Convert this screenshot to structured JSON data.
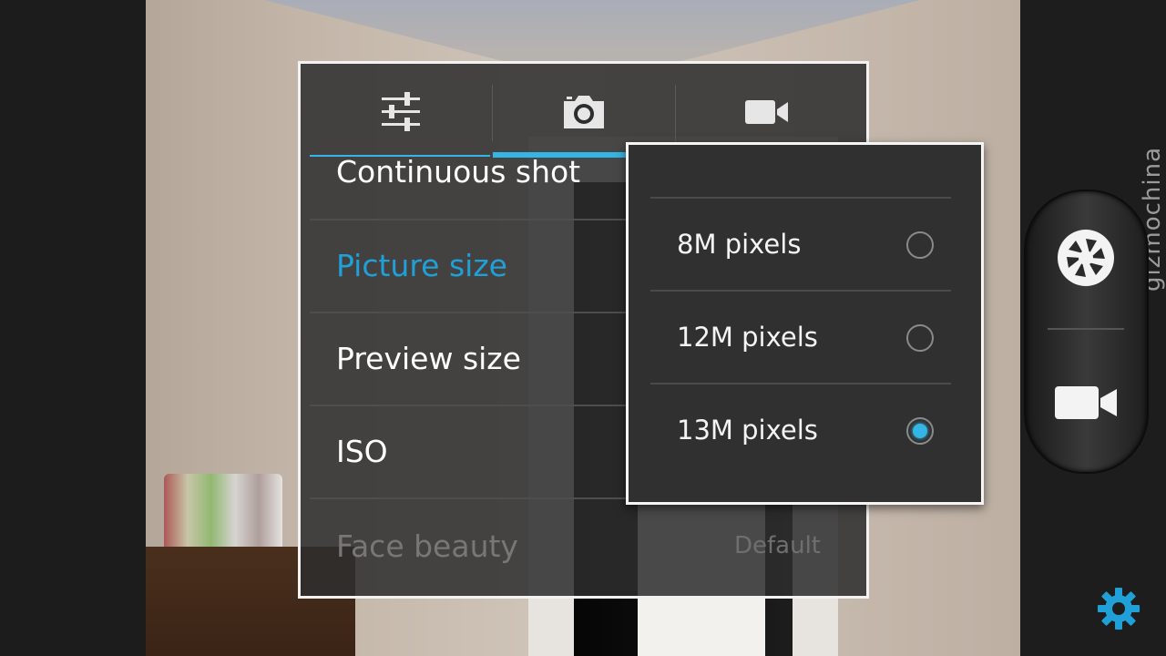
{
  "watermark": "gizmochina",
  "tabs": [
    {
      "icon": "sliders-icon",
      "name": "general-settings"
    },
    {
      "icon": "camera-icon",
      "name": "picture-settings"
    },
    {
      "icon": "video-camera-icon",
      "name": "video-settings"
    }
  ],
  "settings_list": {
    "items": [
      {
        "label": "Continuous shot",
        "value": ""
      },
      {
        "label": "Picture size",
        "value": ""
      },
      {
        "label": "Preview size",
        "value": ""
      },
      {
        "label": "ISO",
        "value": ""
      },
      {
        "label": "Face beauty",
        "value": "Default"
      }
    ]
  },
  "picture_size_menu": {
    "options": [
      {
        "label": "8M pixels",
        "selected": false
      },
      {
        "label": "12M pixels",
        "selected": false
      },
      {
        "label": "13M pixels",
        "selected": true
      }
    ]
  },
  "controls": {
    "shutter": "shutter-icon",
    "video": "video-camera-icon",
    "settings": "gear-icon"
  },
  "colors": {
    "accent": "#33b5e5",
    "active_label": "#1fa0d8"
  }
}
